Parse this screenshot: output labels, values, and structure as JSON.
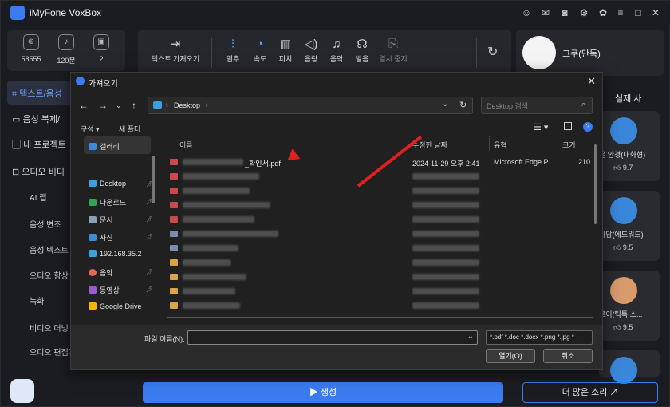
{
  "app": {
    "title": "iMyFone VoxBox"
  },
  "stats": [
    {
      "value": "58555"
    },
    {
      "value": "120분"
    },
    {
      "value": "2"
    }
  ],
  "sidebar": {
    "items": [
      {
        "label": "텍스트/음성"
      },
      {
        "label": "음성 복제/"
      },
      {
        "label": "내 프로젝트"
      },
      {
        "label": "오디오 비디"
      }
    ],
    "subitems": [
      {
        "label": "AI 랩"
      },
      {
        "label": "음성 변조"
      },
      {
        "label": "음성 텍스트 변"
      },
      {
        "label": "오디오 향상"
      },
      {
        "label": "녹화"
      },
      {
        "label": "비디오 더빙"
      },
      {
        "label": "오디오 편집기"
      }
    ]
  },
  "toolbar": {
    "import_label": "텍스트 가져오기",
    "tools": [
      {
        "label": "멈추",
        "icon": "sliders-icon"
      },
      {
        "label": "속도",
        "icon": "speed-icon"
      },
      {
        "label": "피치",
        "icon": "pitch-icon"
      },
      {
        "label": "음량",
        "icon": "volume-icon"
      },
      {
        "label": "음악",
        "icon": "music-icon"
      },
      {
        "label": "발음",
        "icon": "pronounce-icon"
      },
      {
        "label": "열시 중지",
        "icon": "export-icon"
      }
    ]
  },
  "profile": {
    "name": "고쿠(단독)"
  },
  "voices": {
    "header": "실제 사",
    "cards": [
      {
        "name": "은 안경(대화형)",
        "rating": "9.7"
      },
      {
        "name": "아담(에드워드)",
        "rating": "9.5"
      },
      {
        "name": "로이(틱톡 스...",
        "rating": "9.5"
      }
    ]
  },
  "generate_label": "▶ 생성",
  "more_voices_label": "더 많은 소리 ↗",
  "dialog": {
    "title": "가져오기",
    "address": "Desktop",
    "search_placeholder": "Desktop 검색",
    "organize_label": "구성 ▾",
    "new_folder_label": "새 폴더",
    "nav": [
      {
        "label": "갤러리",
        "color": "#3d8bd6"
      },
      {
        "label": "Desktop",
        "color": "#3aa0e0"
      },
      {
        "label": "다운로드",
        "color": "#2fa35a"
      },
      {
        "label": "문서",
        "color": "#8aa0bb"
      },
      {
        "label": "사진",
        "color": "#3d8bd6"
      },
      {
        "label": "192.168.35.2",
        "color": "#3aa0e0"
      },
      {
        "label": "음악",
        "color": "#e06b55"
      },
      {
        "label": "동영상",
        "color": "#9b59d0"
      },
      {
        "label": "Google Drive",
        "color": "#f4b400"
      }
    ],
    "columns": {
      "name": "이름",
      "modified": "수정한 날짜",
      "type": "유형",
      "size": "크기"
    },
    "file": {
      "name": "_확인서.pdf",
      "modified": "2024-11-29 오후 2:41",
      "type": "Microsoft Edge P...",
      "size": "210"
    },
    "filename_label": "파일 이름(N):",
    "filetype": "*.pdf *.doc *.docx *.png *.jpg *",
    "open_label": "열기(O)",
    "cancel_label": "취소"
  },
  "colors": {
    "accent": "#3a7bf0",
    "arrow": "#e02020"
  }
}
